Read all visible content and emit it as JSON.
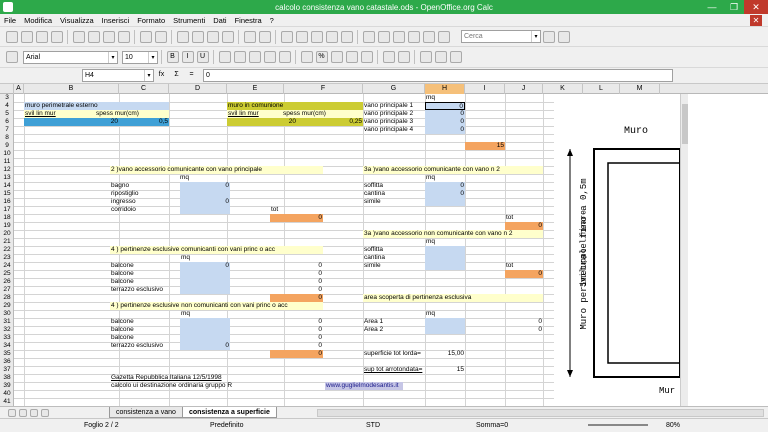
{
  "window": {
    "title": "calcolo consistenza vano catastale.ods - OpenOffice.org Calc"
  },
  "menu": [
    "File",
    "Modifica",
    "Visualizza",
    "Inserisci",
    "Formato",
    "Strumenti",
    "Dati",
    "Finestra",
    "?"
  ],
  "toolbar": {
    "search_placeholder": "Cerca"
  },
  "format": {
    "font": "Arial",
    "size": "10"
  },
  "formula": {
    "cell_ref": "H4",
    "value": "0",
    "fx": "fx",
    "sum": "Σ",
    "eq": "="
  },
  "columns": [
    "A",
    "B",
    "C",
    "D",
    "E",
    "F",
    "G",
    "H",
    "I",
    "J",
    "K",
    "L",
    "M"
  ],
  "rows": [
    "3",
    "4",
    "5",
    "6",
    "7",
    "8",
    "9",
    "10",
    "11",
    "12",
    "13",
    "14",
    "15",
    "16",
    "17",
    "18",
    "19",
    "20",
    "21",
    "22",
    "23",
    "24",
    "25",
    "26",
    "27",
    "28",
    "29",
    "30",
    "31",
    "32",
    "33",
    "34",
    "35",
    "36",
    "37",
    "38",
    "39",
    "40",
    "41"
  ],
  "sheet": {
    "b4": "muro perimetrale esterno",
    "e4": "muro in comunione",
    "b5": "svil lin mur",
    "c5": "spess mur(cm)",
    "e5": "svil lin mur",
    "f5": "spess mur(cm)",
    "b6": "20",
    "c6": "0,5",
    "e6": "20",
    "f6": "0,25",
    "h3": "mq",
    "g4": "vano principale 1",
    "g5": "vano principale 2",
    "g6": "vano principale 3",
    "g7": "vano principale 4",
    "h4": "0",
    "h5": "0",
    "h6": "0",
    "h7": "0",
    "h9": "15",
    "b12": "2 )vano accessorio  comunicante con vano principale",
    "c13": "mq",
    "b14": "bagno",
    "b15": "ripostiglio",
    "b16": "ingresso",
    "b17": "corridoio",
    "c14": "0",
    "c16": "0",
    "d18": "tot",
    "e18": "0",
    "g12": "3a )vano accessorio  comunicante con vano n 2",
    "h13": "mq",
    "g14": "soffitta",
    "g15": "cantina",
    "g16": "simile",
    "h14": "0",
    "h15": "0",
    "i19": "tot",
    "j19": "0",
    "g21": "3a )vano accessorio  non  comunicante con vano n 2",
    "h22": "mq",
    "g23": "soffitta",
    "g24": "cantina",
    "g25": "simile",
    "i25": "tot",
    "j26": "0",
    "b22": "4 ) pertinenze esclusive comunicanti con vani princ o acc",
    "c23": "mq",
    "b24": "balcone",
    "b25": "balcone",
    "b26": "balcone",
    "b27": "terrazzo esclusivo",
    "c24": "0",
    "e24": "0",
    "e25": "0",
    "e26": "0",
    "e27": "0",
    "e28": "0",
    "b29": "4 ) pertinenze esclusive non  comunicanti con vani princ o acc",
    "c30": "mq",
    "b31": "balcone",
    "b32": "balcone",
    "b33": "balcone",
    "b34": "terrazzo esclusivo",
    "c34": "0",
    "e31": "0",
    "e32": "0",
    "e33": "0",
    "e34": "0",
    "e35": "0",
    "g29": "area scoperta di pertinenza esclusiva",
    "h30": "mq",
    "g31": "Area 1",
    "g32": "Area 2",
    "j31": "0",
    "j32": "0",
    "g35": "superficie tot  lorda=",
    "h35": "15,00",
    "g37": "sup tot arrotondata=",
    "h37": "15",
    "b37": "Gazetta Repubblica Italiana 12/5/1998",
    "b38": "calcolo ui destinazione ordinaria  gruppo R",
    "f38": "www.guglielmodesantis.it"
  },
  "diagram": {
    "label_muro": "Muro",
    "label_fino": "Muro perimetrale fino a 0,5m",
    "label_sviluppo": "Sviluppo lineare",
    "label_mur": "Mur"
  },
  "tabs": [
    "consistenza a vano",
    "consistenza a superficie"
  ],
  "status": {
    "sheet": "Foglio 2 / 2",
    "style": "Predefinito",
    "mode": "STD",
    "sum": "Somma=0",
    "zoom": "80%"
  }
}
